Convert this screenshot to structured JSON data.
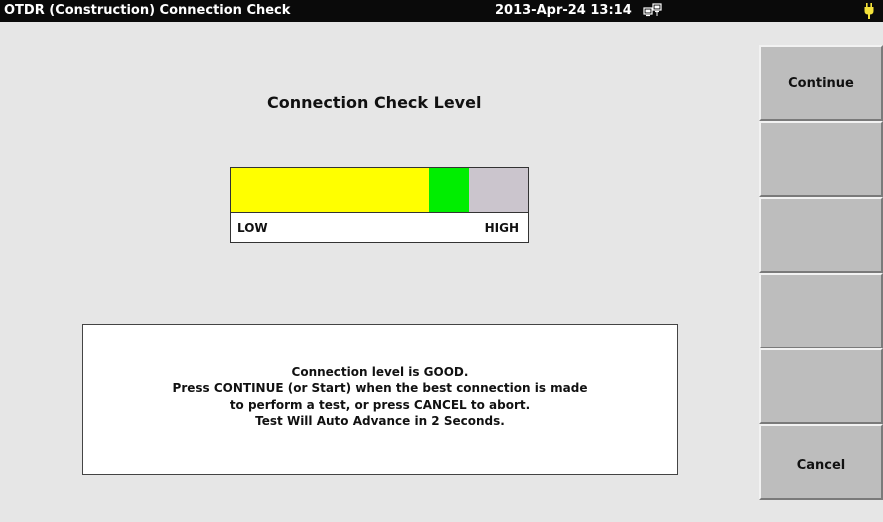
{
  "title_bar": {
    "title": "OTDR (Construction) Connection Check",
    "datetime": "2013-Apr-24 13:14",
    "network_icon": "network-icon",
    "power_icon": "power-icon"
  },
  "main": {
    "heading": "Connection Check Level",
    "meter": {
      "low_label": "LOW",
      "high_label": "HIGH",
      "yellow_fraction": 0.665,
      "green_fraction": 0.135,
      "colors": {
        "low_zone": "#ffff00",
        "good_zone": "#00ee00",
        "high_zone": "#cbc5cd"
      }
    },
    "message": {
      "lines": [
        "Connection level is GOOD.",
        "Press CONTINUE (or Start) when the best connection is made",
        "to perform a test, or press CANCEL to abort.",
        "Test Will Auto Advance in 2 Seconds."
      ]
    }
  },
  "softkeys": [
    {
      "label": "Continue"
    },
    {
      "label": ""
    },
    {
      "label": ""
    },
    {
      "label": ""
    },
    {
      "label": ""
    },
    {
      "label": "Cancel"
    }
  ]
}
